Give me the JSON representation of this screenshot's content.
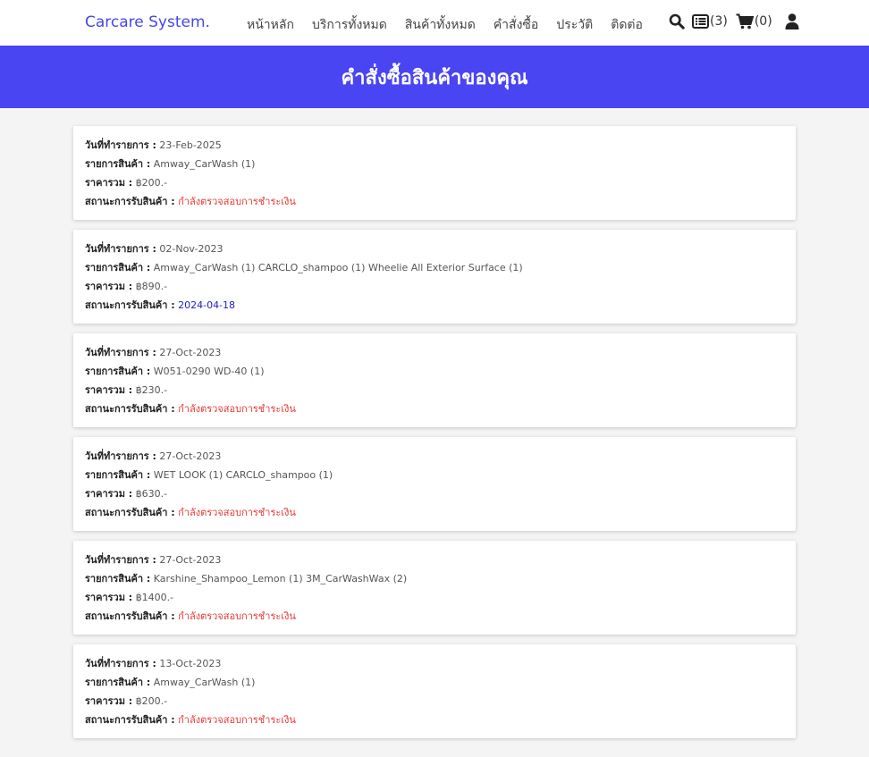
{
  "navbar": {
    "brand": "Carcare System.",
    "links": [
      "หน้าหลัก",
      "บริการทั้งหมด",
      "สินค้าทั้งหมด",
      "คำสั่งซื้อ",
      "ประวัติ",
      "ติดต่อ"
    ],
    "order_count": "(3)",
    "cart_count": "(0)"
  },
  "banner": {
    "title": "คำสั่งซื้อสินค้าของคุณ"
  },
  "labels": {
    "date": "วันที่ทำรายการ :",
    "items": "รายการสินค้า :",
    "total": "ราคารวม :",
    "status": "สถานะการรับสินค้า :"
  },
  "orders": [
    {
      "date": "23-Feb-2025",
      "items": "Amway_CarWash (1)",
      "total": "฿200.-",
      "status": "กำลังตรวจสอบการชำระเงิน",
      "status_type": "pending"
    },
    {
      "date": "02-Nov-2023",
      "items": "Amway_CarWash (1) CARCLO_shampoo (1) Wheelie All Exterior Surface (1)",
      "total": "฿890.-",
      "status": "2024-04-18",
      "status_type": "date"
    },
    {
      "date": "27-Oct-2023",
      "items": "W051-0290 WD-40 (1)",
      "total": "฿230.-",
      "status": "กำลังตรวจสอบการชำระเงิน",
      "status_type": "pending"
    },
    {
      "date": "27-Oct-2023",
      "items": "WET LOOK (1) CARCLO_shampoo (1)",
      "total": "฿630.-",
      "status": "กำลังตรวจสอบการชำระเงิน",
      "status_type": "pending"
    },
    {
      "date": "27-Oct-2023",
      "items": "Karshine_Shampoo_Lemon (1) 3M_CarWashWax (2)",
      "total": "฿1400.-",
      "status": "กำลังตรวจสอบการชำระเงิน",
      "status_type": "pending"
    },
    {
      "date": "13-Oct-2023",
      "items": "Amway_CarWash (1)",
      "total": "฿200.-",
      "status": "กำลังตรวจสอบการชำระเงิน",
      "status_type": "pending"
    }
  ],
  "colors": {
    "brand": "#4747e8",
    "banner": "#4a45f2",
    "pending": "#e53935",
    "date_status": "#1c1ccc"
  }
}
